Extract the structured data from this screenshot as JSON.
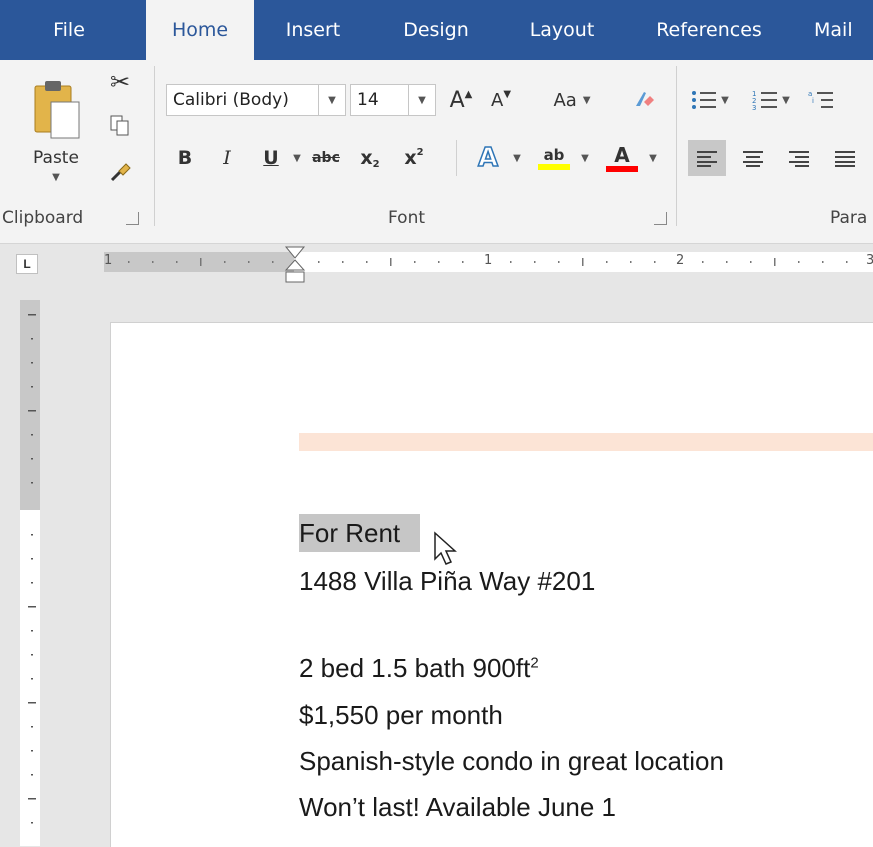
{
  "tabs": [
    {
      "label": "File",
      "active": false
    },
    {
      "label": "Home",
      "active": true
    },
    {
      "label": "Insert",
      "active": false
    },
    {
      "label": "Design",
      "active": false
    },
    {
      "label": "Layout",
      "active": false
    },
    {
      "label": "References",
      "active": false
    },
    {
      "label": "Mail",
      "active": false
    }
  ],
  "clipboard": {
    "paste_label": "Paste",
    "group_label": "Clipboard"
  },
  "font": {
    "font_name": "Calibri (Body)",
    "font_size": "14",
    "group_label": "Font",
    "grow": "A",
    "shrink": "A",
    "change_case": "Aa",
    "bold": "B",
    "italic": "I",
    "underline": "U",
    "strike": "abc",
    "subscript": "x",
    "superscript": "x",
    "text_effects": "A",
    "highlight": "ab",
    "font_color": "A",
    "highlight_color": "#ffff00",
    "font_color_value": "#ff0000"
  },
  "paragraph": {
    "group_label": "Para"
  },
  "ruler": {
    "numbers": [
      "1",
      "1",
      "2",
      "3"
    ]
  },
  "document": {
    "line1": "For Rent",
    "line2": "1488 Villa Piña Way #201",
    "line3_main": "2 bed 1.5 bath 900ft",
    "line3_sup": "2",
    "line4": "$1,550 per month",
    "line5": "Spanish-style condo in great location",
    "line6": "Won’t last! Available June 1",
    "header_band_color": "#fce4d6"
  },
  "colors": {
    "accent": "#2b579a",
    "selection": "#c6c6c6"
  }
}
